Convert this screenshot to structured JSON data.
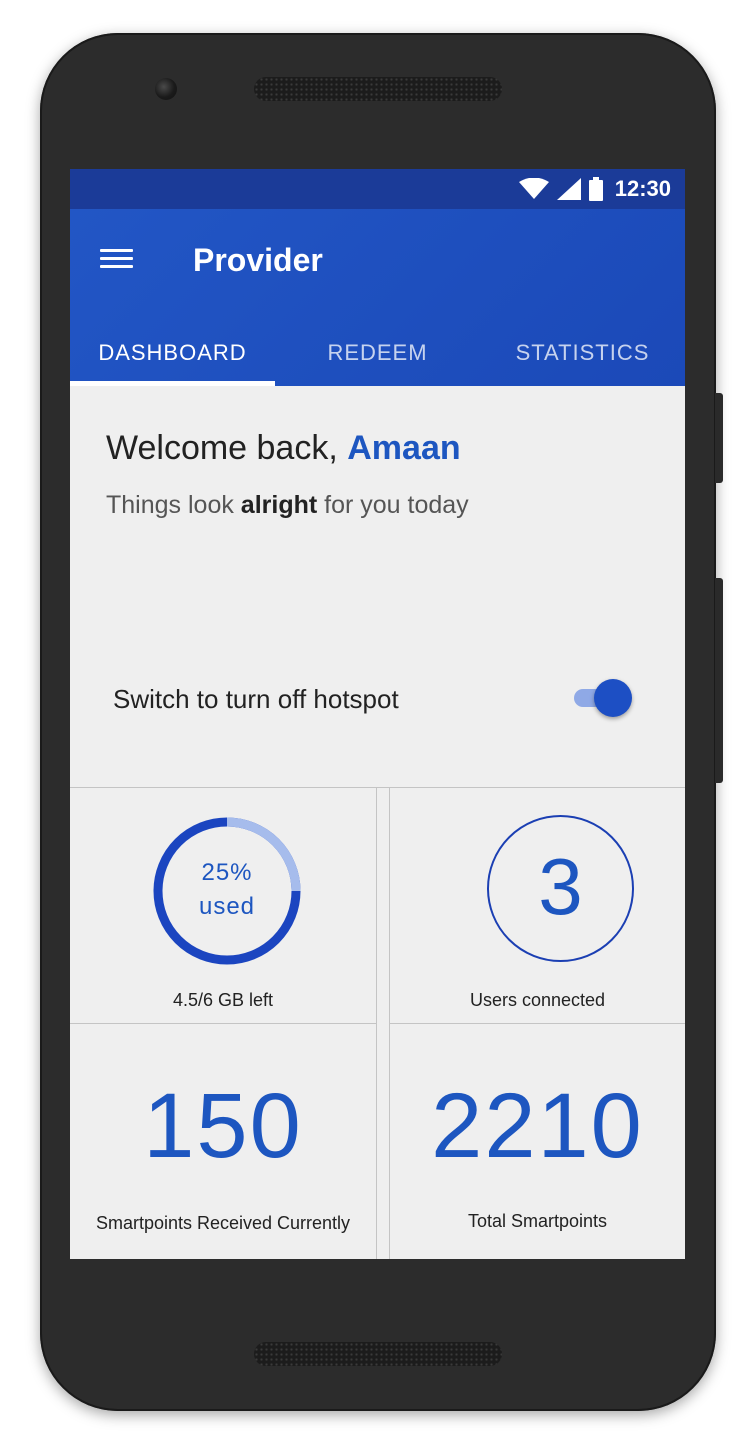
{
  "status_bar": {
    "time": "12:30",
    "icons": [
      "wifi-icon",
      "signal-icon",
      "battery-icon"
    ]
  },
  "app_bar": {
    "title": "Provider",
    "menu_icon": "menu-icon"
  },
  "tabs": [
    {
      "label": "DASHBOARD",
      "active": true
    },
    {
      "label": "REDEEM",
      "active": false
    },
    {
      "label": "STATISTICS",
      "active": false
    }
  ],
  "welcome": {
    "greeting": "Welcome back, ",
    "name": "Amaan",
    "subtitle_pre": "Things look ",
    "subtitle_emphasis": "alright",
    "subtitle_post": " for you today"
  },
  "hotspot": {
    "label": "Switch to turn off hotspot",
    "enabled": true
  },
  "stats": {
    "data_usage": {
      "percent_label": "25%",
      "used_label": "used",
      "fraction_used": 0.25,
      "caption": "4.5/6 GB left"
    },
    "users": {
      "value": "3",
      "caption": "Users connected"
    },
    "smartpoints_current": {
      "value": "150",
      "caption": "Smartpoints Received Currently"
    },
    "smartpoints_total": {
      "value": "2210",
      "caption": "Total Smartpoints"
    }
  },
  "colors": {
    "status_bar": "#1b3b98",
    "app_bar": "#2256c5",
    "accent": "#1d56c0",
    "background": "#efefef"
  }
}
